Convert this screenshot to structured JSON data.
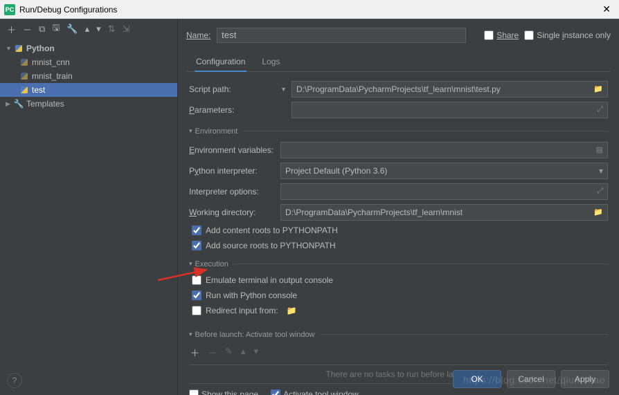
{
  "window": {
    "title": "Run/Debug Configurations"
  },
  "tree": {
    "python": {
      "label": "Python"
    },
    "items": [
      "mnist_cnn",
      "mnist_train",
      "test"
    ],
    "templates": {
      "label": "Templates"
    }
  },
  "form": {
    "nameLabel": "Name:",
    "nameValue": "test",
    "share": "Share",
    "singleInstance": "Single instance only",
    "tabs": {
      "config": "Configuration",
      "logs": "Logs"
    },
    "scriptPathLabel": "Script path:",
    "scriptPathValue": "D:\\ProgramData\\PycharmProjects\\tf_learn\\mnist\\test.py",
    "parametersLabel": "Parameters:",
    "envSection": "Environment",
    "envVarsLabel": "Environment variables:",
    "pyInterpLabel": "Python interpreter:",
    "pyInterpValue": "Project Default (Python 3.6)",
    "interpOptsLabel": "Interpreter options:",
    "workDirLabel": "Working directory:",
    "workDirValue": "D:\\ProgramData\\PycharmProjects\\tf_learn\\mnist",
    "addContentRoots": "Add content roots to PYTHONPATH",
    "addSourceRoots": "Add source roots to PYTHONPATH",
    "execSection": "Execution",
    "emulateTerminal": "Emulate terminal in output console",
    "runPyConsole": "Run with Python console",
    "redirectInput": "Redirect input from:",
    "beforeLaunch": "Before launch: Activate tool window",
    "noTasks": "There are no tasks to run before launch",
    "showPage": "Show this page",
    "activateTool": "Activate tool window"
  },
  "buttons": {
    "ok": "OK",
    "cancel": "Cancel",
    "apply": "Apply"
  },
  "watermark": "https://blog.csdn.net/qiumokao"
}
